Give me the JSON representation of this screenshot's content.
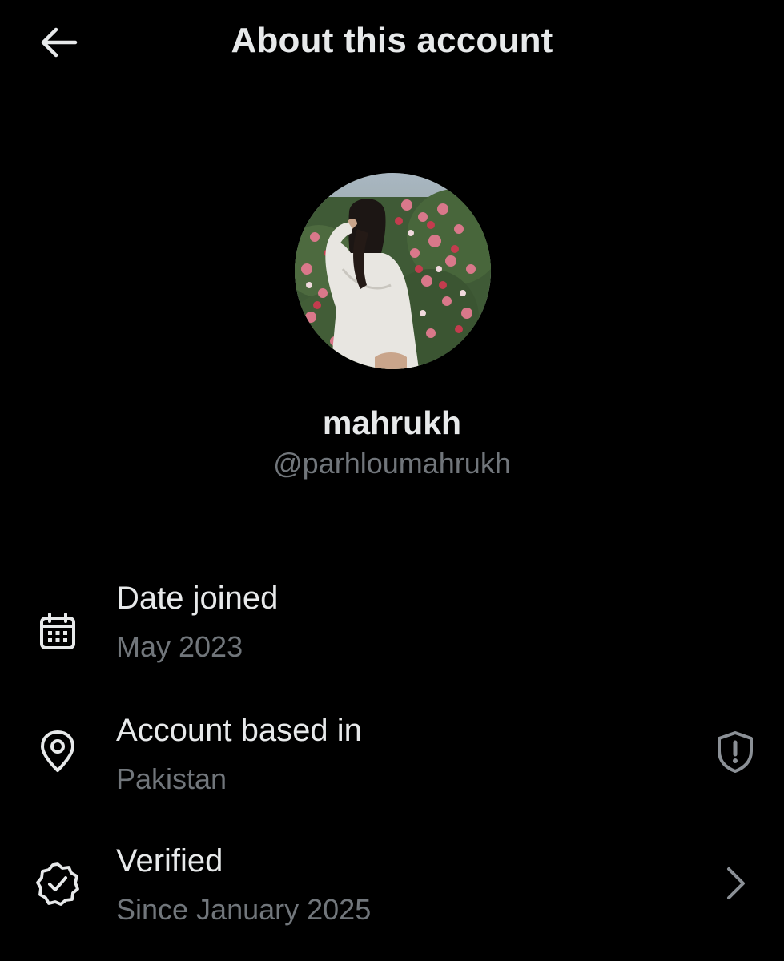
{
  "header": {
    "title": "About this account",
    "back_icon": "arrow-left-icon"
  },
  "profile": {
    "display_name": "mahrukh",
    "handle": "@parhloumahrukh",
    "avatar_description": "profile-photo"
  },
  "rows": [
    {
      "title": "Date joined",
      "value": "May 2023",
      "icon": "calendar-icon"
    },
    {
      "title": "Account based in",
      "value": "Pakistan",
      "icon": "location-pin-icon",
      "trailing_icon": "shield-alert-icon"
    },
    {
      "title": "Verified",
      "value": "Since January 2025",
      "icon": "verified-badge-icon",
      "trailing_icon": "chevron-right-icon"
    }
  ],
  "colors": {
    "background": "#000000",
    "primary_text": "#e7e9ea",
    "secondary_text": "#71767b"
  }
}
